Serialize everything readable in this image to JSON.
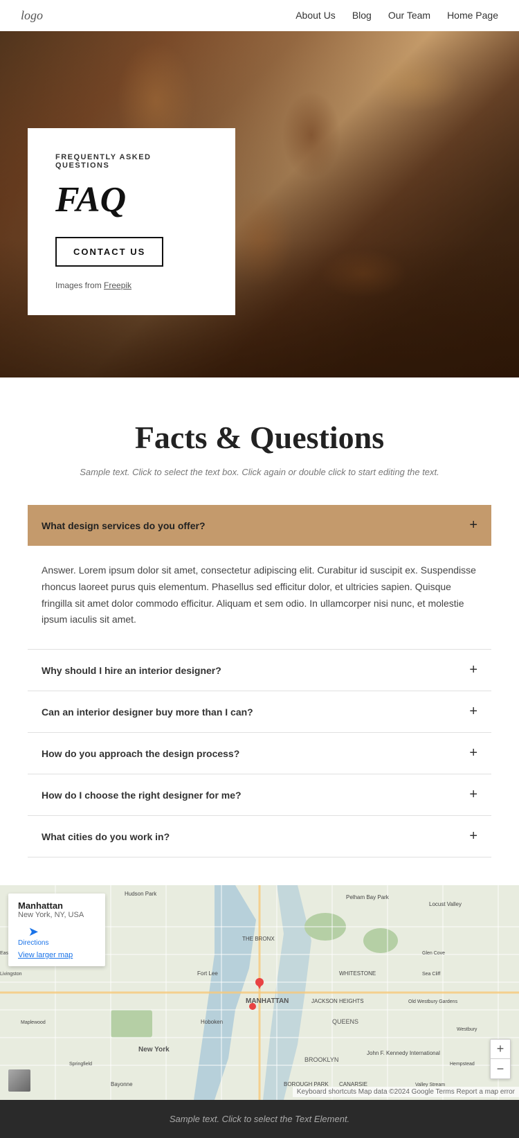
{
  "nav": {
    "logo": "logo",
    "links": [
      {
        "label": "About Us",
        "href": "#"
      },
      {
        "label": "Blog",
        "href": "#"
      },
      {
        "label": "Our Team",
        "href": "#"
      },
      {
        "label": "Home Page",
        "href": "#"
      }
    ]
  },
  "hero": {
    "subtitle": "FREQUENTLY ASKED QUESTIONS",
    "title": "FAQ",
    "contact_btn": "CONTACT US",
    "images_prefix": "Images from ",
    "images_link_text": "Freepik"
  },
  "faq": {
    "title": "Facts & Questions",
    "subtitle": "Sample text. Click to select the text box. Click again or double click to start editing the text.",
    "accordion": [
      {
        "question": "What design services do you offer?",
        "answer": "Answer. Lorem ipsum dolor sit amet, consectetur adipiscing elit. Curabitur id suscipit ex. Suspendisse rhoncus laoreet purus quis elementum. Phasellus sed efficitur dolor, et ultricies sapien. Quisque fringilla sit amet dolor commodo efficitur. Aliquam et sem odio. In ullamcorper nisi nunc, et molestie ipsum iaculis sit amet.",
        "active": true
      },
      {
        "question": "Why should I hire an interior designer?",
        "answer": "",
        "active": false
      },
      {
        "question": "Can an interior designer buy more than I can?",
        "answer": "",
        "active": false
      },
      {
        "question": "How do you approach the design process?",
        "answer": "",
        "active": false
      },
      {
        "question": "How do I choose the right designer for me?",
        "answer": "",
        "active": false
      },
      {
        "question": "What cities do you work in?",
        "answer": "",
        "active": false
      }
    ]
  },
  "map": {
    "popup_title": "Manhattan",
    "popup_address_line1": "New York, NY, USA",
    "directions_label": "Directions",
    "view_larger": "View larger map",
    "attribution": "Keyboard shortcuts  Map data ©2024 Google  Terms  Report a map error"
  },
  "footer": {
    "text": "Sample text. Click to select the Text Element."
  }
}
